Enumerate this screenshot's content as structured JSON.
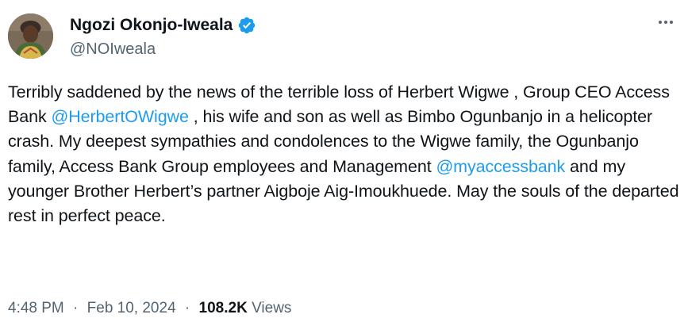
{
  "author": {
    "display_name": "Ngozi Okonjo-Iweala",
    "handle": "@NOIweala",
    "verified_color": "#1d9bf0"
  },
  "tweet": {
    "segments": [
      {
        "type": "text",
        "value": "Terribly saddened by the news of the terrible loss of Herbert Wigwe , Group CEO Access Bank "
      },
      {
        "type": "mention",
        "value": "@HerbertOWigwe"
      },
      {
        "type": "text",
        "value": " , his wife and son as well as Bimbo Ogunbanjo in a helicopter crash. My deepest sympathies and condolences to the Wigwe family, the Ogunbanjo family, Access Bank Group employees and Management "
      },
      {
        "type": "mention",
        "value": "@myaccessbank"
      },
      {
        "type": "text",
        "value": " and my younger Brother Herbert’s partner Aigboje Aig-Imoukhuede. May the souls of the departed rest in perfect peace."
      }
    ]
  },
  "meta": {
    "time": "4:48 PM",
    "separator": "·",
    "date": "Feb 10, 2024",
    "views_count": "108.2K",
    "views_label": "Views"
  },
  "icons": {
    "more": "more-horizontal-icon",
    "verified": "verified-badge-icon"
  }
}
